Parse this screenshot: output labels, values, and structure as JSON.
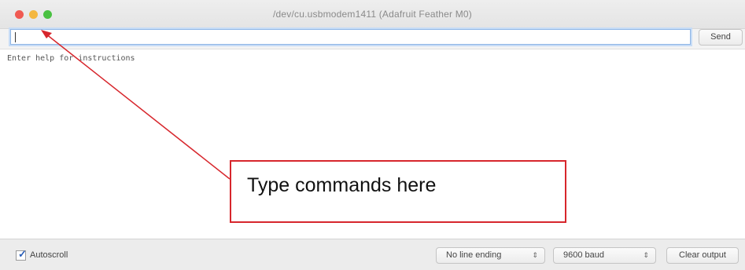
{
  "window": {
    "title": "/dev/cu.usbmodem1411 (Adafruit Feather M0)"
  },
  "toolbar": {
    "input_value": "",
    "send_label": "Send"
  },
  "output": {
    "lines": [
      "Enter help for instructions"
    ]
  },
  "footer": {
    "autoscroll_label": "Autoscroll",
    "autoscroll_checked": true,
    "line_ending_selected": "No line ending",
    "baud_selected": "9600 baud",
    "clear_label": "Clear output"
  },
  "annotation": {
    "callout_text": "Type commands here",
    "color": "#d7262c"
  },
  "icons": {
    "close": "close-icon",
    "minimize": "minimize-icon",
    "zoom": "zoom-icon",
    "checkmark": "checkmark-icon",
    "stepper": "updown-arrows-icon"
  }
}
